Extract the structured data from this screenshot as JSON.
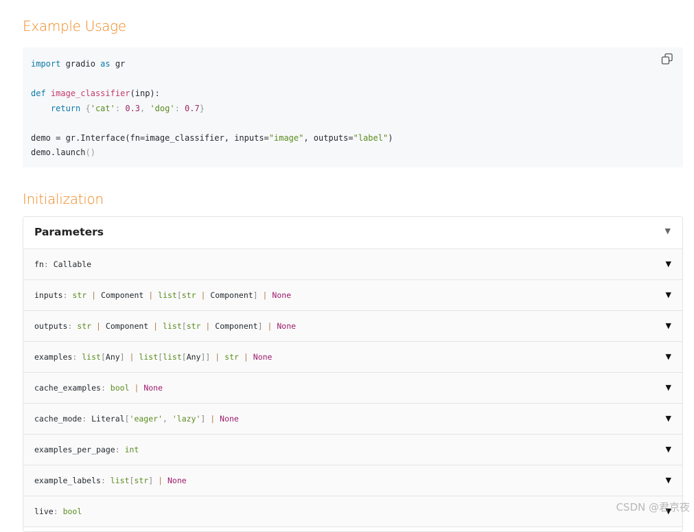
{
  "sections": {
    "example_usage": "Example Usage",
    "initialization": "Initialization"
  },
  "code": {
    "copy_icon": "copy-icon",
    "line1": {
      "kw1": "import",
      "mid": " gradio ",
      "kw2": "as",
      "end": " gr"
    },
    "line2": {
      "kw": "def",
      "name": "image_classifier",
      "args": "(inp):"
    },
    "line3": {
      "kw": "return",
      "open": "{",
      "k1": "'cat'",
      "v1": "0.3",
      "k2": "'dog'",
      "v2": "0.7",
      "close": "}"
    },
    "line4": {
      "a": "demo = gr.Interface(fn=image_classifier, inputs=",
      "s1": "\"image\"",
      "b": ", outputs=",
      "s2": "\"label\"",
      "c": ")"
    },
    "line5": {
      "a": "demo.launch",
      "b": "()"
    }
  },
  "parameters": {
    "title": "Parameters",
    "rows": [
      {
        "name": "fn",
        "type": "Callable"
      },
      {
        "name": "inputs",
        "type": "str | Component | list[str | Component] | None"
      },
      {
        "name": "outputs",
        "type": "str | Component | list[str | Component] | None"
      },
      {
        "name": "examples",
        "type": "list[Any] | list[list[Any]] | str | None"
      },
      {
        "name": "cache_examples",
        "type": "bool | None"
      },
      {
        "name": "cache_mode",
        "type": "Literal['eager', 'lazy'] | None"
      },
      {
        "name": "examples_per_page",
        "type": "int"
      },
      {
        "name": "example_labels",
        "type": "list[str] | None"
      },
      {
        "name": "live",
        "type": "bool"
      }
    ]
  },
  "watermark": "CSDN @君京夜",
  "colors": {
    "accent": "#f0861c",
    "string": "#5b8c1f",
    "none": "#9c1a6b",
    "keyword": "#0a7aa6"
  }
}
